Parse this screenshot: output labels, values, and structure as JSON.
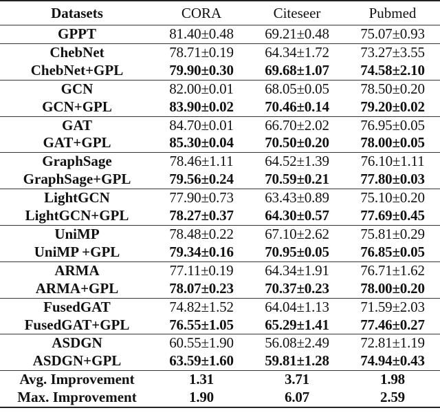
{
  "table": {
    "headers": [
      "Datasets",
      "CORA",
      "Citeseer",
      "Pubmed"
    ],
    "groups": [
      {
        "rows": [
          {
            "name": "GPPT",
            "values": [
              "81.40±0.48",
              "69.21±0.48",
              "75.07±0.93"
            ],
            "bold": false
          }
        ]
      },
      {
        "rows": [
          {
            "name": "ChebNet",
            "values": [
              "78.71±0.19",
              "64.34±1.72",
              "73.27±3.55"
            ],
            "bold": false
          },
          {
            "name": "ChebNet+GPL",
            "values": [
              "79.90±0.30",
              "69.68±1.07",
              "74.58±2.10"
            ],
            "bold": true
          }
        ]
      },
      {
        "rows": [
          {
            "name": "GCN",
            "values": [
              "82.00±0.01",
              "68.05±0.05",
              "78.50±0.20"
            ],
            "bold": false
          },
          {
            "name": "GCN+GPL",
            "values": [
              "83.90±0.02",
              "70.46±0.14",
              "79.20±0.02"
            ],
            "bold": true
          }
        ]
      },
      {
        "rows": [
          {
            "name": "GAT",
            "values": [
              "84.70±0.01",
              "66.70±2.02",
              "76.95±0.05"
            ],
            "bold": false
          },
          {
            "name": "GAT+GPL",
            "values": [
              "85.30±0.04",
              "70.50±0.20",
              "78.00±0.05"
            ],
            "bold": true
          }
        ]
      },
      {
        "rows": [
          {
            "name": "GraphSage",
            "values": [
              "78.46±1.11",
              "64.52±1.39",
              "76.10±1.11"
            ],
            "bold": false
          },
          {
            "name": "GraphSage+GPL",
            "values": [
              "79.56±0.24",
              "70.59±0.21",
              "77.80±0.03"
            ],
            "bold": true
          }
        ]
      },
      {
        "rows": [
          {
            "name": "LightGCN",
            "values": [
              "77.90±0.73",
              "63.43±0.89",
              "75.10±0.20"
            ],
            "bold": false
          },
          {
            "name": "LightGCN+GPL",
            "values": [
              "78.27±0.37",
              "64.30±0.57",
              "77.69±0.45"
            ],
            "bold": true
          }
        ]
      },
      {
        "rows": [
          {
            "name": "UniMP",
            "values": [
              "78.48±0.22",
              "67.10±2.62",
              "75.81±0.29"
            ],
            "bold": false
          },
          {
            "name": "UniMP +GPL",
            "values": [
              "79.34±0.16",
              "70.95±0.05",
              "76.85±0.05"
            ],
            "bold": true
          }
        ]
      },
      {
        "rows": [
          {
            "name": "ARMA",
            "values": [
              "77.11±0.19",
              "64.34±1.91",
              "76.71±1.62"
            ],
            "bold": false
          },
          {
            "name": "ARMA+GPL",
            "values": [
              "78.07±0.23",
              "70.37±0.23",
              "78.00±0.20"
            ],
            "bold": true
          }
        ]
      },
      {
        "rows": [
          {
            "name": "FusedGAT",
            "values": [
              "74.82±1.52",
              "64.04±1.13",
              "71.59±2.03"
            ],
            "bold": false
          },
          {
            "name": "FusedGAT+GPL",
            "values": [
              "76.55±1.05",
              "65.29±1.41",
              "77.46±0.27"
            ],
            "bold": true
          }
        ]
      },
      {
        "rows": [
          {
            "name": "ASDGN",
            "values": [
              "60.55±1.90",
              "56.08±2.49",
              "72.81±1.19"
            ],
            "bold": false
          },
          {
            "name": "ASDGN+GPL",
            "values": [
              "63.59±1.60",
              "59.81±1.28",
              "74.94±0.43"
            ],
            "bold": true
          }
        ]
      },
      {
        "rows": [
          {
            "name": "Avg. Improvement",
            "values": [
              "1.31",
              "3.71",
              "1.98"
            ],
            "bold": true
          },
          {
            "name": "Max. Improvement",
            "values": [
              "1.90",
              "6.07",
              "2.59"
            ],
            "bold": true
          }
        ]
      }
    ]
  }
}
